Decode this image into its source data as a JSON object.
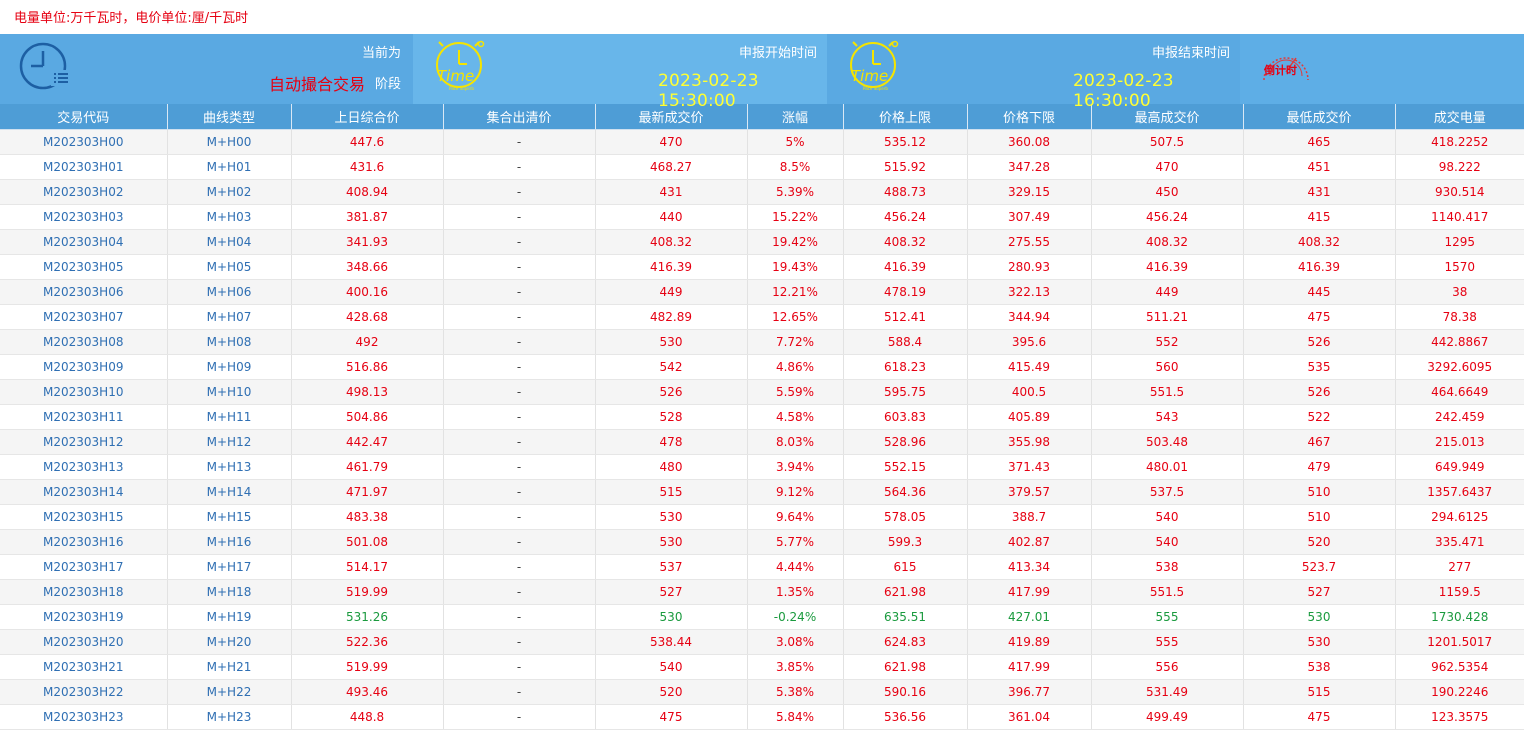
{
  "unit_note": "电量单位:万千瓦时，电价单位:厘/千瓦时",
  "status": {
    "current_label": "当前为",
    "current_value": "自动撮合交易",
    "stage_label": "阶段",
    "start_label": "申报开始时间",
    "start_time": "2023-02-23 15:30:00",
    "end_label": "申报结束时间",
    "end_time": "2023-02-23 16:30:00",
    "clock_word": "Time",
    "clock_small": "Pace Superb",
    "countdown_label": "倒计时"
  },
  "colors": {
    "up": "#e60012",
    "down": "#1a9a3e",
    "code": "#2f6fb3",
    "header_bg": "#4e9dd6",
    "banner_bg": "#5eaee6",
    "time_yellow": "#ffff33"
  },
  "table": {
    "headers": [
      "交易代码",
      "曲线类型",
      "上日综合价",
      "集合出清价",
      "最新成交价",
      "涨幅",
      "价格上限",
      "价格下限",
      "最高成交价",
      "最低成交价",
      "成交电量"
    ],
    "rows": [
      [
        "M202303H00",
        "M+H00",
        "447.6",
        "-",
        "470",
        "5%",
        "535.12",
        "360.08",
        "507.5",
        "465",
        "418.2252"
      ],
      [
        "M202303H01",
        "M+H01",
        "431.6",
        "-",
        "468.27",
        "8.5%",
        "515.92",
        "347.28",
        "470",
        "451",
        "98.222"
      ],
      [
        "M202303H02",
        "M+H02",
        "408.94",
        "-",
        "431",
        "5.39%",
        "488.73",
        "329.15",
        "450",
        "431",
        "930.514"
      ],
      [
        "M202303H03",
        "M+H03",
        "381.87",
        "-",
        "440",
        "15.22%",
        "456.24",
        "307.49",
        "456.24",
        "415",
        "1140.417"
      ],
      [
        "M202303H04",
        "M+H04",
        "341.93",
        "-",
        "408.32",
        "19.42%",
        "408.32",
        "275.55",
        "408.32",
        "408.32",
        "1295"
      ],
      [
        "M202303H05",
        "M+H05",
        "348.66",
        "-",
        "416.39",
        "19.43%",
        "416.39",
        "280.93",
        "416.39",
        "416.39",
        "1570"
      ],
      [
        "M202303H06",
        "M+H06",
        "400.16",
        "-",
        "449",
        "12.21%",
        "478.19",
        "322.13",
        "449",
        "445",
        "38"
      ],
      [
        "M202303H07",
        "M+H07",
        "428.68",
        "-",
        "482.89",
        "12.65%",
        "512.41",
        "344.94",
        "511.21",
        "475",
        "78.38"
      ],
      [
        "M202303H08",
        "M+H08",
        "492",
        "-",
        "530",
        "7.72%",
        "588.4",
        "395.6",
        "552",
        "526",
        "442.8867"
      ],
      [
        "M202303H09",
        "M+H09",
        "516.86",
        "-",
        "542",
        "4.86%",
        "618.23",
        "415.49",
        "560",
        "535",
        "3292.6095"
      ],
      [
        "M202303H10",
        "M+H10",
        "498.13",
        "-",
        "526",
        "5.59%",
        "595.75",
        "400.5",
        "551.5",
        "526",
        "464.6649"
      ],
      [
        "M202303H11",
        "M+H11",
        "504.86",
        "-",
        "528",
        "4.58%",
        "603.83",
        "405.89",
        "543",
        "522",
        "242.459"
      ],
      [
        "M202303H12",
        "M+H12",
        "442.47",
        "-",
        "478",
        "8.03%",
        "528.96",
        "355.98",
        "503.48",
        "467",
        "215.013"
      ],
      [
        "M202303H13",
        "M+H13",
        "461.79",
        "-",
        "480",
        "3.94%",
        "552.15",
        "371.43",
        "480.01",
        "479",
        "649.949"
      ],
      [
        "M202303H14",
        "M+H14",
        "471.97",
        "-",
        "515",
        "9.12%",
        "564.36",
        "379.57",
        "537.5",
        "510",
        "1357.6437"
      ],
      [
        "M202303H15",
        "M+H15",
        "483.38",
        "-",
        "530",
        "9.64%",
        "578.05",
        "388.7",
        "540",
        "510",
        "294.6125"
      ],
      [
        "M202303H16",
        "M+H16",
        "501.08",
        "-",
        "530",
        "5.77%",
        "599.3",
        "402.87",
        "540",
        "520",
        "335.471"
      ],
      [
        "M202303H17",
        "M+H17",
        "514.17",
        "-",
        "537",
        "4.44%",
        "615",
        "413.34",
        "538",
        "523.7",
        "277"
      ],
      [
        "M202303H18",
        "M+H18",
        "519.99",
        "-",
        "527",
        "1.35%",
        "621.98",
        "417.99",
        "551.5",
        "527",
        "1159.5"
      ],
      [
        "M202303H19",
        "M+H19",
        "531.26",
        "-",
        "530",
        "-0.24%",
        "635.51",
        "427.01",
        "555",
        "530",
        "1730.428"
      ],
      [
        "M202303H20",
        "M+H20",
        "522.36",
        "-",
        "538.44",
        "3.08%",
        "624.83",
        "419.89",
        "555",
        "530",
        "1201.5017"
      ],
      [
        "M202303H21",
        "M+H21",
        "519.99",
        "-",
        "540",
        "3.85%",
        "621.98",
        "417.99",
        "556",
        "538",
        "962.5354"
      ],
      [
        "M202303H22",
        "M+H22",
        "493.46",
        "-",
        "520",
        "5.38%",
        "590.16",
        "396.77",
        "531.49",
        "515",
        "190.2246"
      ],
      [
        "M202303H23",
        "M+H23",
        "448.8",
        "-",
        "475",
        "5.84%",
        "536.56",
        "361.04",
        "499.49",
        "475",
        "123.3575"
      ]
    ]
  }
}
